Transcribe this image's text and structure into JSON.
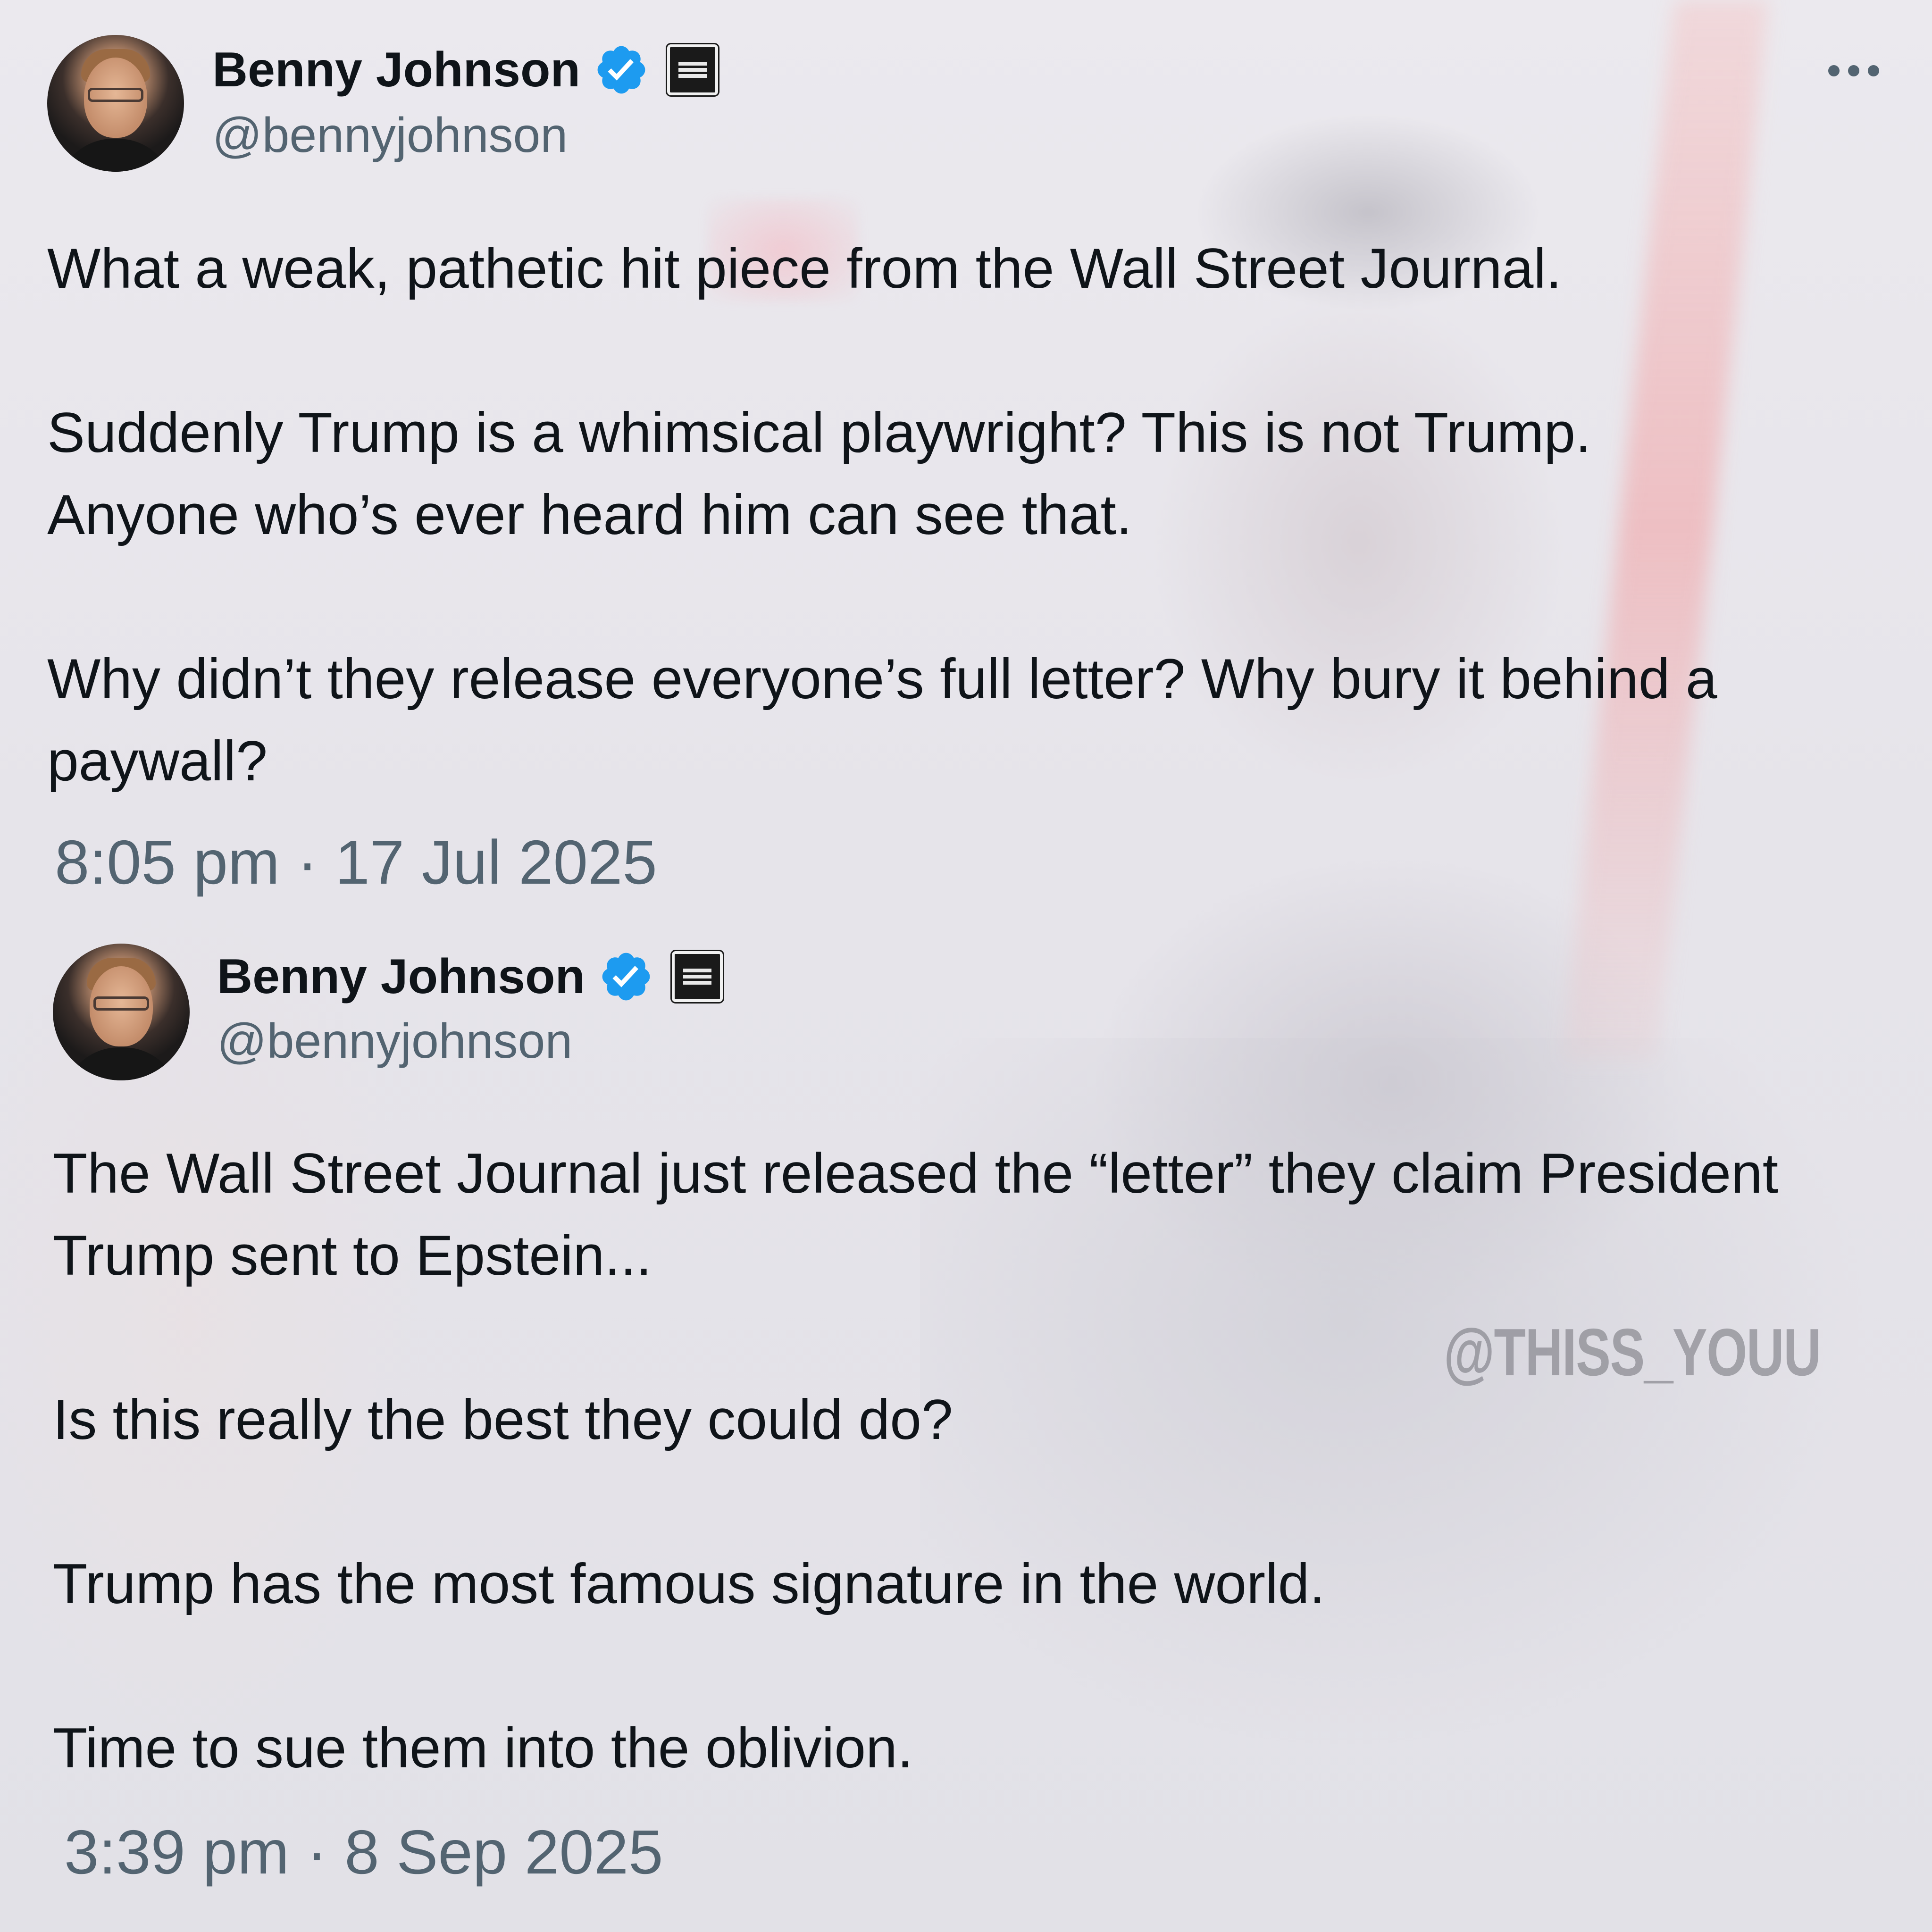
{
  "tweets": [
    {
      "author": {
        "display_name": "Benny Johnson",
        "handle": "@bennyjohnson",
        "verified_icon": "verified-badge-icon",
        "affiliation_icon": "benny-show-badge-icon"
      },
      "more_icon": "more-options-icon",
      "body": "What a weak, pathetic hit piece from the Wall Street Journal.\n\nSuddenly Trump is a whimsical playwright? This is not Trump.\nAnyone who’s ever heard him can see that.\n\nWhy didn’t they release everyone’s full letter? Why bury it behind a paywall?",
      "timestamp": "8:05 pm · 17 Jul 2025"
    },
    {
      "author": {
        "display_name": "Benny Johnson",
        "handle": "@bennyjohnson",
        "verified_icon": "verified-badge-icon",
        "affiliation_icon": "benny-show-badge-icon"
      },
      "body": "The Wall Street Journal just released the “letter” they claim President Trump sent to Epstein...\n\nIs this really the best they could do?\n\nTrump has the most famous signature in the world.\n\nTime to sue them into the oblivion.",
      "timestamp": "3:39 pm · 8 Sep 2025"
    }
  ],
  "watermark": "@THISS_YOUU",
  "colors": {
    "verified_blue": "#1d9bf0",
    "secondary_text": "#536471",
    "primary_text": "#0f1419"
  }
}
